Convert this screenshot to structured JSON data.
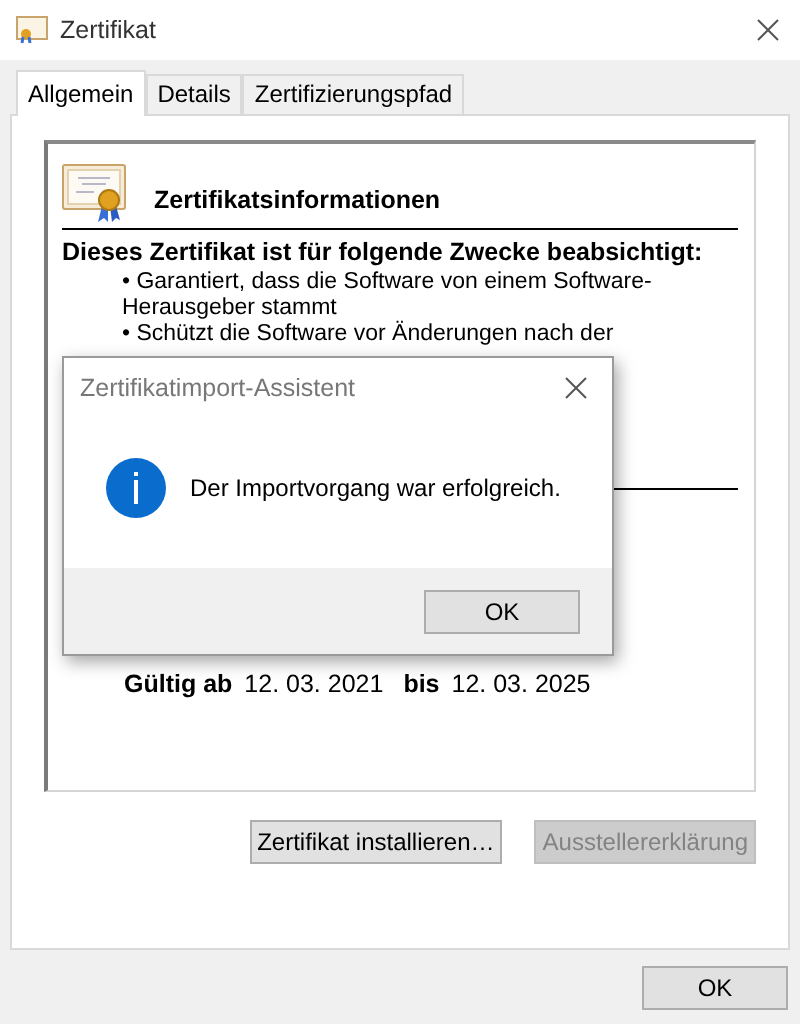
{
  "window": {
    "title": "Zertifikat"
  },
  "tabs": [
    {
      "label": "Allgemein",
      "selected": true
    },
    {
      "label": "Details",
      "selected": false
    },
    {
      "label": "Zertifizierungspfad",
      "selected": false
    }
  ],
  "certificate_info": {
    "heading": "Zertifikatsinformationen",
    "purpose_heading": "Dieses Zertifikat ist für folgende Zwecke beabsichtigt:",
    "purposes": [
      "• Garantiert, dass die Software von einem Software-Herausgeber stammt",
      "• Schützt die Software vor Änderungen nach der"
    ],
    "valid_from_label": "Gültig ab",
    "valid_from": "12. 03. 2021",
    "valid_to_label": "bis",
    "valid_to": "12. 03. 2025"
  },
  "buttons": [
    {
      "label": "Zertifikat installieren…",
      "disabled": false
    },
    {
      "label": "Ausstellererklärung",
      "disabled": true
    }
  ],
  "ok_button": "OK",
  "dialog": {
    "title": "Zertifikatimport-Assistent",
    "message": "Der Importvorgang war erfolgreich.",
    "button": "OK"
  }
}
